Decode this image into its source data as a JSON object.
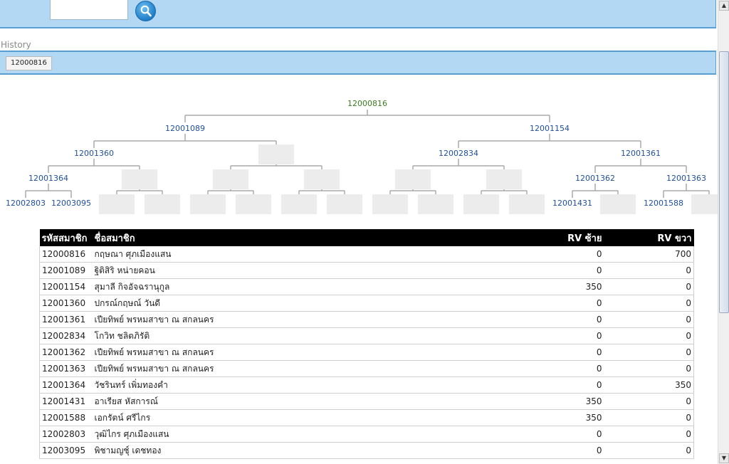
{
  "search": {
    "placeholder": "",
    "value": ""
  },
  "history": {
    "label": "History",
    "items": [
      "12000816"
    ]
  },
  "tree": {
    "root": "12000816",
    "level1": [
      "12001089",
      "12001154"
    ],
    "level2": [
      "12001360",
      "12002834",
      "12001361"
    ],
    "level3": [
      "12001364",
      "12001362",
      "12001363"
    ],
    "level4": [
      "12002803",
      "12003095",
      "12001431",
      "12001588"
    ]
  },
  "table": {
    "headers": {
      "id": "รหัสสมาชิก",
      "name": "ชื่อสมาชิก",
      "left": "RV ซ้าย",
      "right": "RV ขวา"
    },
    "rows": [
      {
        "id": "12000816",
        "name": "กฤษณา ศุภเมืองแสน",
        "left": "0",
        "right": "700"
      },
      {
        "id": "12001089",
        "name": "ฐิติสิริ หน่ายคอน",
        "left": "0",
        "right": "0"
      },
      {
        "id": "12001154",
        "name": "สุมาลี กิจอัจฉรานุกูล",
        "left": "350",
        "right": "0"
      },
      {
        "id": "12001360",
        "name": "ปกรณ์กฤษณ์ วันดี",
        "left": "0",
        "right": "0"
      },
      {
        "id": "12001361",
        "name": "เปียทิพย์ พรหมสาขา ณ สกลนคร",
        "left": "0",
        "right": "0"
      },
      {
        "id": "12002834",
        "name": "โกวิท ชลิตภิรัติ",
        "left": "0",
        "right": "0"
      },
      {
        "id": "12001362",
        "name": "เปียทิพย์ พรหมสาขา ณ สกลนคร",
        "left": "0",
        "right": "0"
      },
      {
        "id": "12001363",
        "name": "เปียทิพย์ พรหมสาขา ณ สกลนคร",
        "left": "0",
        "right": "0"
      },
      {
        "id": "12001364",
        "name": "วัชรินทร์ เพิ่มทองคำ",
        "left": "0",
        "right": "350"
      },
      {
        "id": "12001431",
        "name": "อาเรียส หัสการณ์",
        "left": "350",
        "right": "0"
      },
      {
        "id": "12001588",
        "name": "เอกรัตน์ ศรีไกร",
        "left": "350",
        "right": "0"
      },
      {
        "id": "12002803",
        "name": "วุฒิไกร ศุภเมืองแสน",
        "left": "0",
        "right": "0"
      },
      {
        "id": "12003095",
        "name": "พิชามญชุ์ เดชทอง",
        "left": "0",
        "right": "0"
      }
    ]
  },
  "colors": {
    "bar": "#b3d8f3",
    "border": "#5a9fd4",
    "link": "#1f4f9e",
    "root": "#3b7d1e"
  }
}
